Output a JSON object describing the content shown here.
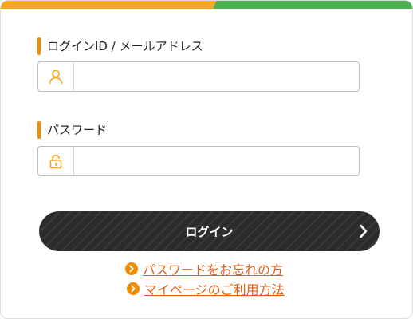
{
  "login_id": {
    "label": "ログインID / メールアドレス",
    "value": "",
    "icon": "user-icon"
  },
  "password": {
    "label": "パスワード",
    "value": "",
    "icon": "lock-icon"
  },
  "login_button": {
    "label": "ログイン",
    "icon": "chevron-right-icon"
  },
  "links": [
    {
      "label": "パスワードをお忘れの方",
      "icon": "circle-chevron-right-icon"
    },
    {
      "label": "マイページのご利用方法",
      "icon": "circle-chevron-right-icon"
    }
  ],
  "colors": {
    "accent_orange": "#f5a623",
    "accent_green": "#4caf50",
    "label_marker": "#f08c00",
    "link": "#e0601a",
    "button": "#2b2b2b"
  }
}
